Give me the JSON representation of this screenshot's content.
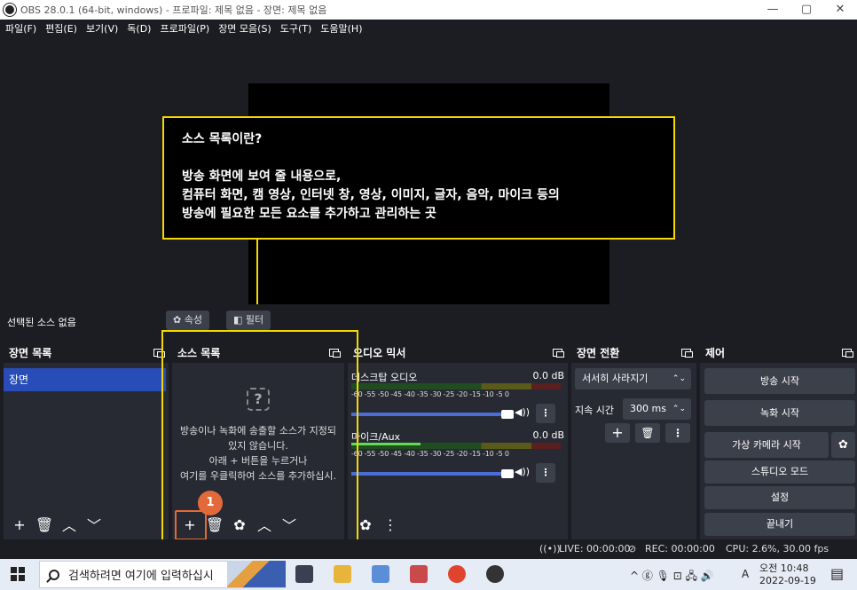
{
  "window": {
    "title": "OBS 28.0.1 (64-bit, windows) - 프로파일: 제목 없음 - 장면: 제목 없음",
    "min": "—",
    "max": "▢",
    "close": "✕"
  },
  "menu": [
    "파일(F)",
    "편집(E)",
    "보기(V)",
    "독(D)",
    "프로파일(P)",
    "장면 모음(S)",
    "도구(T)",
    "도움말(H)"
  ],
  "callout": {
    "title": "소스 목록이란?",
    "line1": "방송 화면에 보여 줄 내용으로,",
    "line2": "컴퓨터 화면, 캠 영상, 인터넷 창, 영상, 이미지, 글자, 음악, 마이크 등의",
    "line3": "방송에 필요한 모든 요소를 추가하고 관리하는 곳"
  },
  "propbar": {
    "no_selection": "선택된 소스 없음",
    "properties": "속성",
    "filters": "필터"
  },
  "scenes": {
    "title": "장면 목록",
    "items": [
      "장면"
    ]
  },
  "sources": {
    "title": "소스 목록",
    "empty": [
      "방송이나 녹화에 송출할 소스가 지정되",
      "있지 않습니다.",
      "아래 + 버튼을 누르거나",
      "여기를 우클릭하여 소스를 추가하십시."
    ],
    "badge": "1"
  },
  "mixer": {
    "title": "오디오 믹서",
    "ticks": "-60 -55 -50 -45 -40 -35 -30 -25 -20 -15 -10 -5 0",
    "channels": [
      {
        "name": "데스크탑 오디오",
        "db": "0.0 dB"
      },
      {
        "name": "마이크/Aux",
        "db": "0.0 dB"
      }
    ]
  },
  "transitions": {
    "title": "장면 전환",
    "type": "서서히 사라지기",
    "duration_label": "지속 시간",
    "duration": "300 ms"
  },
  "controls": {
    "title": "제어",
    "buttons": [
      "방송 시작",
      "녹화 시작",
      "가상 카메라 시작",
      "스튜디오 모드",
      "설정",
      "끝내기"
    ]
  },
  "status": {
    "live": "LIVE: 00:00:00",
    "rec": "REC: 00:00:00",
    "cpu": "CPU: 2.6%, 30.00 fps"
  },
  "taskbar": {
    "search_placeholder": "검색하려면 여기에 입력하십시",
    "time": "오전 10:48",
    "date": "2022-09-19",
    "lang": "A",
    "tray": "^ ⓖ 🎙 ⊡ 🖧 🔊"
  },
  "colors": {
    "highlight": "#f5d800",
    "accent": "#284cb8",
    "badge": "#e26a3a"
  }
}
